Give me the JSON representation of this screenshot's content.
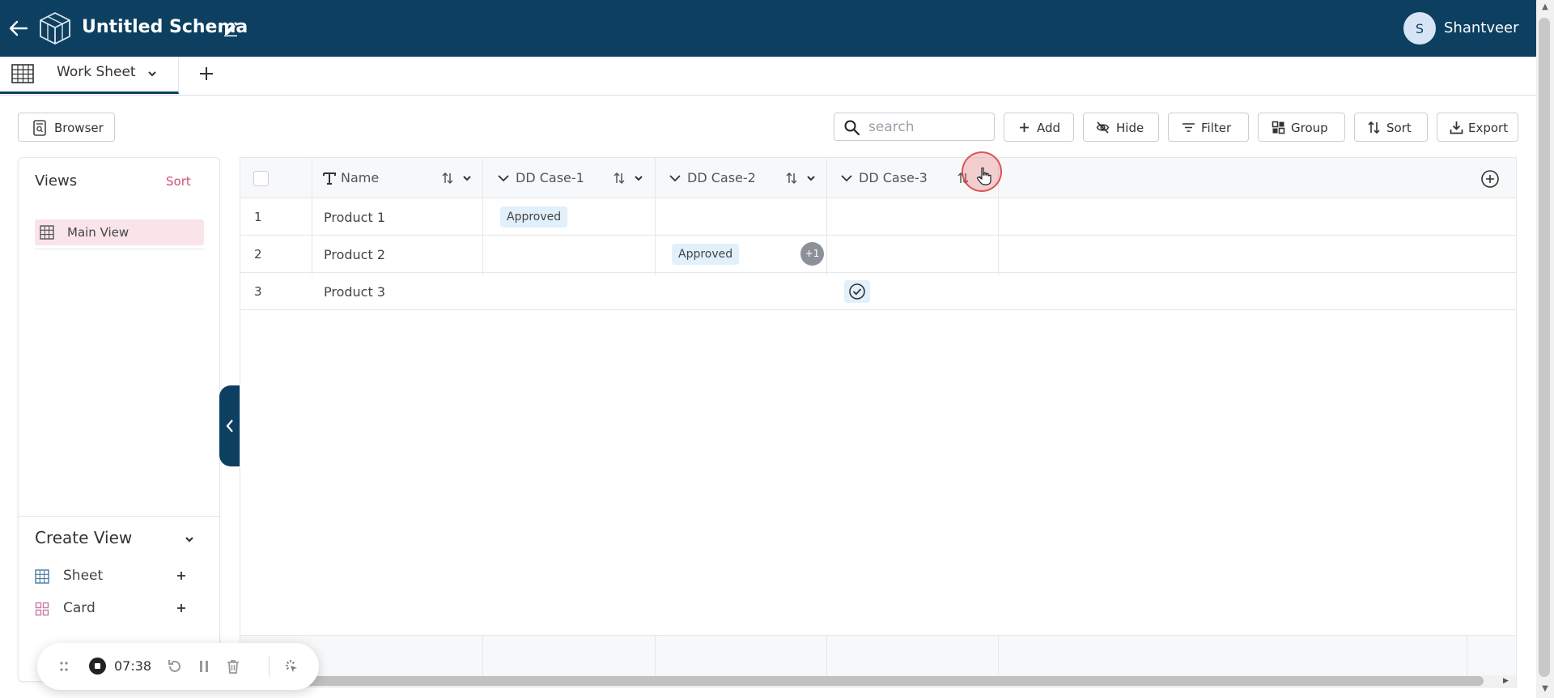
{
  "header": {
    "title": "Untitled Schema",
    "user_initial": "S",
    "user_name": "Shantveer"
  },
  "tabs": {
    "active_label": "Work Sheet"
  },
  "toolbar": {
    "browser_label": "Browser",
    "search_placeholder": "search",
    "search_value": "",
    "add_label": "Add",
    "hide_label": "Hide",
    "filter_label": "Filter",
    "group_label": "Group",
    "sort_label": "Sort",
    "export_label": "Export"
  },
  "views_panel": {
    "title": "Views",
    "sort_label": "Sort",
    "items": [
      {
        "label": "Main View",
        "icon": "grid-icon",
        "active": true
      }
    ],
    "create_title": "Create View",
    "create_items": [
      {
        "label": "Sheet",
        "icon": "grid-icon"
      },
      {
        "label": "Card",
        "icon": "card-icon"
      }
    ]
  },
  "grid": {
    "columns": [
      {
        "label": "Name",
        "type": "text"
      },
      {
        "label": "DD Case-1",
        "type": "dropdown"
      },
      {
        "label": "DD Case-2",
        "type": "dropdown"
      },
      {
        "label": "DD Case-3",
        "type": "dropdown"
      }
    ],
    "rows": [
      {
        "num": "1",
        "name": "Product 1",
        "dd1": "Approved",
        "dd2": "",
        "dd3": ""
      },
      {
        "num": "2",
        "name": "Product 2",
        "dd1": "",
        "dd2": "Approved",
        "dd2_extra": "+1",
        "dd3": ""
      },
      {
        "num": "3",
        "name": "Product 3",
        "dd1": "",
        "dd2": "",
        "dd3": "check-circle-icon"
      }
    ]
  },
  "recorder": {
    "time": "07:38"
  },
  "colors": {
    "header_bg": "#0d4060",
    "accent_pink": "#d0506e",
    "badge_bg": "#e1f0fb",
    "active_view_bg": "#f9e4ea"
  }
}
